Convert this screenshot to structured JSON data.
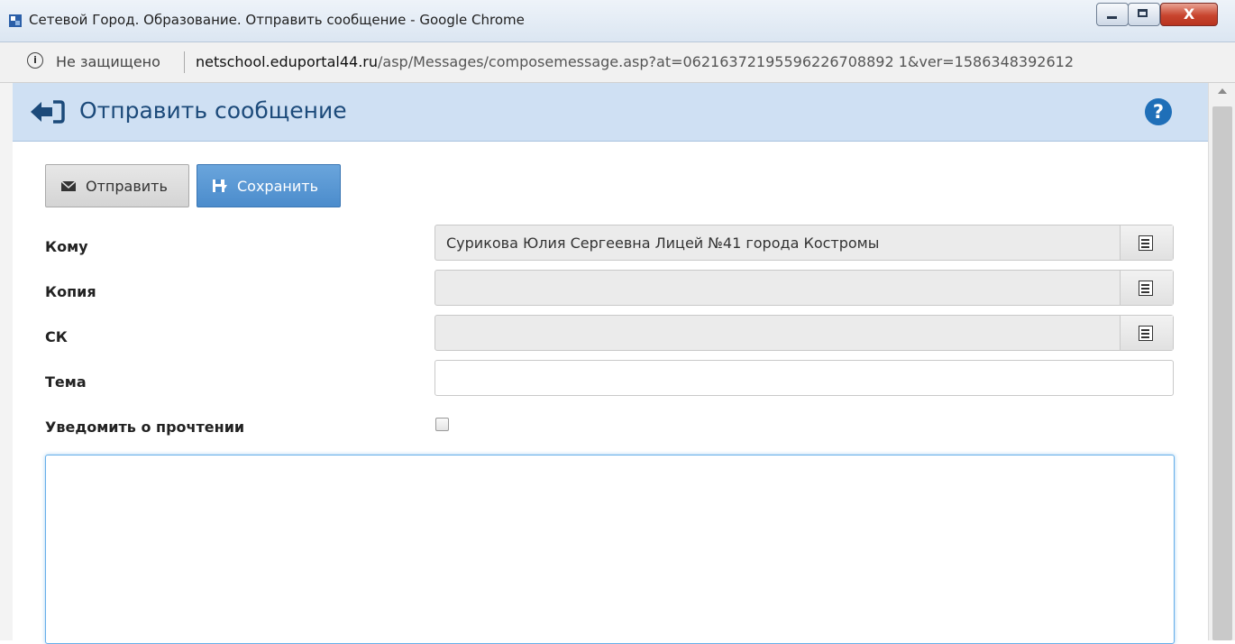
{
  "window": {
    "title": "Сетевой Город. Образование. Отправить сообщение - Google Chrome",
    "close_glyph": "X"
  },
  "addressbar": {
    "security_label": "Не защищено",
    "url_host": "netschool.eduportal44.ru",
    "url_path": "/asp/Messages/composemessage.asp?at=06216372195596226708892 1&ver=1586348392612"
  },
  "header": {
    "title": "Отправить сообщение",
    "help_glyph": "?"
  },
  "toolbar": {
    "send_label": "Отправить",
    "save_label": "Сохранить"
  },
  "form": {
    "to_label": "Кому",
    "to_value": "Сурикова Юлия Сергеевна Лицей №41 города Костромы",
    "cc_label": "Копия",
    "cc_value": "",
    "bcc_label": "СК",
    "bcc_value": "",
    "subject_label": "Тема",
    "subject_value": "",
    "notify_label": "Уведомить о прочтении",
    "notify_checked": false,
    "body_value": ""
  },
  "colors": {
    "header_bg": "#cfe0f3",
    "title_color": "#1c4a7a",
    "save_button": "#4b8ccc",
    "help_icon": "#1f6fb8"
  }
}
